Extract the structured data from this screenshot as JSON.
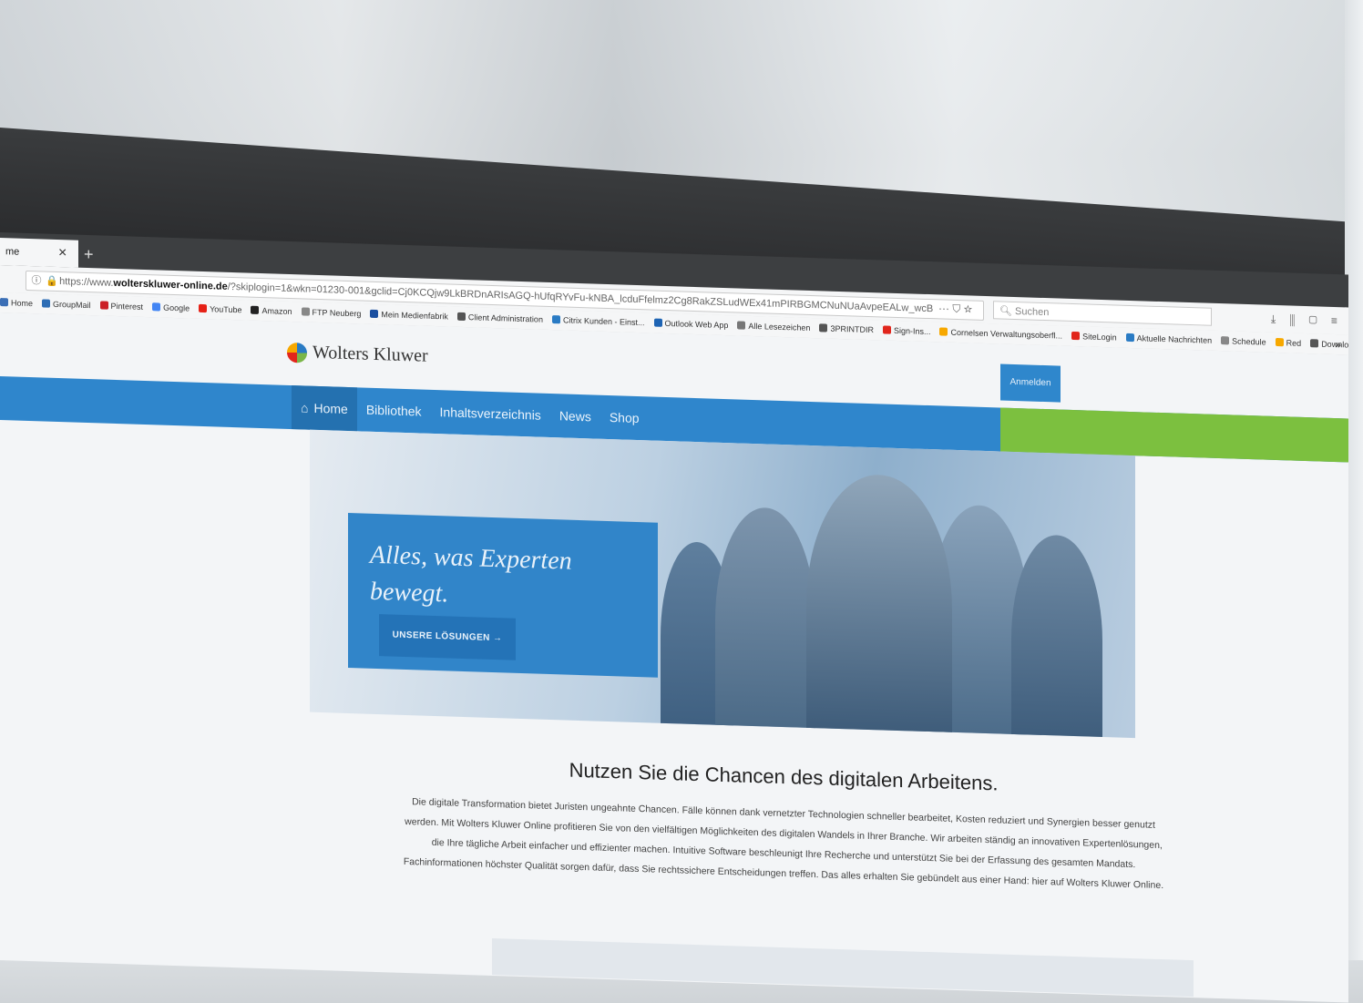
{
  "browser": {
    "tab_label": "me",
    "tab_close": "×",
    "tab_new": "+",
    "url_info": "ⓘ",
    "url_lock": "🔒",
    "url_prefix": "https://www.",
    "url_domain": "wolterskluwer-online.de",
    "url_rest": "/?skiplogin=1&wkn=01230-001&gclid=Cj0KCQjw9LkBRDnARIsAGQ-hUfqRYvFu-kNBA_lcduFfelmz2Cg8RakZSLudWEx41mPIRBGMCNuNUaAvpeEALw_wcB",
    "url_actions": "··· ⛉ ☆",
    "search_placeholder": "Suchen",
    "toolbar_icons": "⤓ ⫼ ▢ ≡",
    "bookmarks": [
      {
        "label": "Home",
        "color": "#3b6fb6"
      },
      {
        "label": "GroupMail",
        "color": "#2d6db5"
      },
      {
        "label": "Pinterest",
        "color": "#cb2027"
      },
      {
        "label": "Google",
        "color": "#4285f4"
      },
      {
        "label": "YouTube",
        "color": "#e62117"
      },
      {
        "label": "Amazon",
        "color": "#222222"
      },
      {
        "label": "FTP Neuberg",
        "color": "#888888"
      },
      {
        "label": "Mein Medienfabrik",
        "color": "#1a4fa0"
      },
      {
        "label": "Client Administration",
        "color": "#555555"
      },
      {
        "label": "Citrix Kunden - Einst...",
        "color": "#2a7bc4"
      },
      {
        "label": "Outlook Web App",
        "color": "#1e64b4"
      },
      {
        "label": "Alle Lesezeichen",
        "color": "#777777"
      },
      {
        "label": "3PRINTDIR",
        "color": "#555555"
      },
      {
        "label": "Sign-Ins...",
        "color": "#e1261c"
      },
      {
        "label": "Cornelsen Verwaltungsoberfl...",
        "color": "#f7a800"
      },
      {
        "label": "SiteLogin",
        "color": "#e1261c"
      },
      {
        "label": "Aktuelle Nachrichten",
        "color": "#2a7bc4"
      },
      {
        "label": "Schedule",
        "color": "#888888"
      },
      {
        "label": "Red",
        "color": "#f7a800"
      },
      {
        "label": "DownloadX",
        "color": "#555555"
      }
    ],
    "bookmarks_more": "»"
  },
  "page": {
    "logo_text": "Wolters Kluwer",
    "login_button": "Anmelden",
    "menu": [
      "Home",
      "Bibliothek",
      "Inhaltsverzeichnis",
      "News",
      "Shop"
    ],
    "home_icon": "⌂",
    "hero_title": "Alles, was Experten bewegt.",
    "hero_button": "UNSERE LÖSUNGEN →",
    "headline": "Nutzen Sie die Chancen des digitalen Arbeitens.",
    "body": "Die digitale Transformation bietet Juristen ungeahnte Chancen. Fälle können dank vernetzter Technologien schneller bearbeitet, Kosten reduziert und Synergien besser genutzt werden. Mit Wolters Kluwer Online profitieren Sie von den vielfältigen Möglichkeiten des digitalen Wandels in Ihrer Branche. Wir arbeiten ständig an innovativen Expertenlösungen, die Ihre tägliche Arbeit einfacher und effizienter machen. Intuitive Software beschleunigt Ihre Recherche und unterstützt Sie bei der Erfassung des gesamten Mandats. Fachinformationen höchster Qualität sorgen dafür, dass Sie rechtssichere Entscheidungen treffen. Das alles erhalten Sie gebündelt aus einer Hand: hier auf Wolters Kluwer Online."
  }
}
